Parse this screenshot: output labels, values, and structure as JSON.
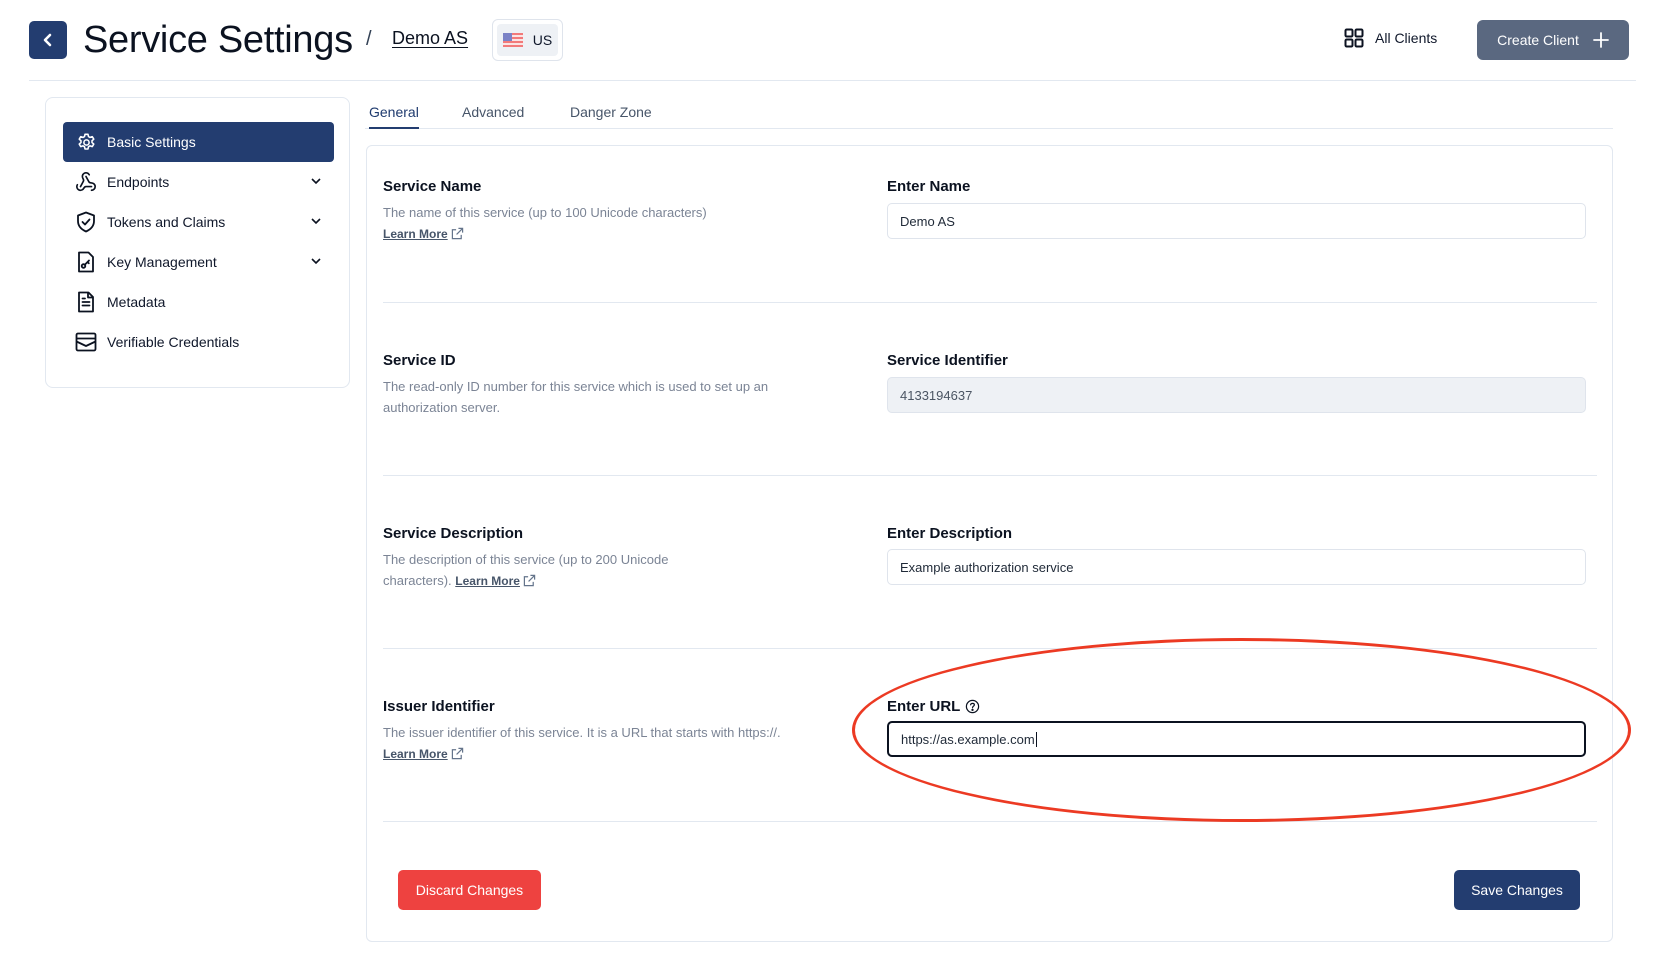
{
  "header": {
    "back_label": "Back",
    "title": "Service Settings",
    "separator": "/",
    "breadcrumb_service": "Demo AS",
    "region": "US",
    "all_clients_label": "All Clients",
    "create_client_label": "Create Client"
  },
  "sidebar": {
    "items": [
      {
        "label": "Basic Settings",
        "icon": "gear-icon",
        "active": true,
        "expandable": false
      },
      {
        "label": "Endpoints",
        "icon": "webhook-icon",
        "active": false,
        "expandable": true
      },
      {
        "label": "Tokens and Claims",
        "icon": "shield-check-icon",
        "active": false,
        "expandable": true
      },
      {
        "label": "Key Management",
        "icon": "file-key-icon",
        "active": false,
        "expandable": true
      },
      {
        "label": "Metadata",
        "icon": "document-icon",
        "active": false,
        "expandable": false
      },
      {
        "label": "Verifiable Credentials",
        "icon": "credential-icon",
        "active": false,
        "expandable": false
      }
    ]
  },
  "tabs": [
    {
      "label": "General",
      "active": true
    },
    {
      "label": "Advanced",
      "active": false
    },
    {
      "label": "Danger Zone",
      "active": false
    }
  ],
  "sections": {
    "service_name": {
      "title": "Service Name",
      "description": "The name of this service (up to 100 Unicode characters)",
      "learn_more": "Learn More",
      "field_label": "Enter Name",
      "value": "Demo AS"
    },
    "service_id": {
      "title": "Service ID",
      "description": "The read-only ID number for this service which is used to set up an authorization server.",
      "field_label": "Service Identifier",
      "value": "4133194637"
    },
    "service_description": {
      "title": "Service Description",
      "description": "The description of this service (up to 200 Unicode characters).",
      "learn_more": "Learn More",
      "field_label": "Enter Description",
      "value": "Example authorization service"
    },
    "issuer_identifier": {
      "title": "Issuer Identifier",
      "description": "The issuer identifier of this service. It is a URL that starts with https://.",
      "learn_more": "Learn More",
      "field_label": "Enter URL",
      "value": "https://as.example.com"
    }
  },
  "actions": {
    "discard_label": "Discard Changes",
    "save_label": "Save Changes"
  },
  "colors": {
    "primary": "#233d70",
    "danger": "#ee4240",
    "secondary_button": "#5a6880",
    "annotation": "#ec3a23"
  }
}
